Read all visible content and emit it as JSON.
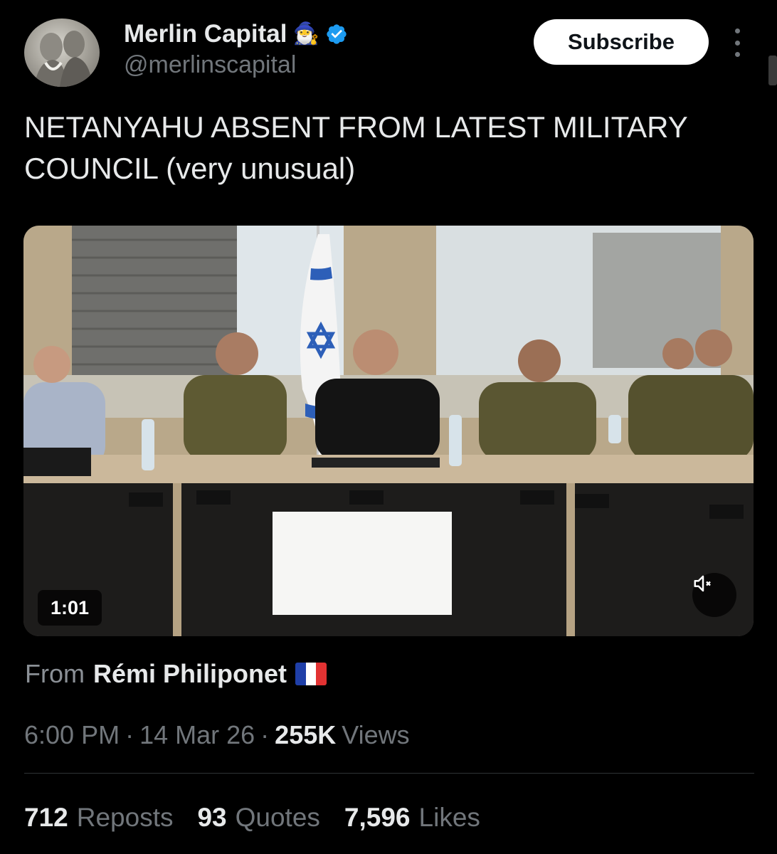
{
  "author": {
    "display_name": "Merlin Capital",
    "emoji": "🧙‍♂️",
    "handle": "@merlinscapital"
  },
  "actions": {
    "subscribe_label": "Subscribe"
  },
  "tweet": {
    "text": "NETANYAHU ABSENT FROM LATEST MILITARY COUNCIL (very unusual)"
  },
  "media": {
    "duration": "1:01"
  },
  "source": {
    "from_label": "From",
    "name": "Rémi Philiponet"
  },
  "meta": {
    "time": "6:00 PM",
    "sep1": "·",
    "date": "14 Mar 26",
    "sep2": "·",
    "views_count": "255K",
    "views_label": "Views"
  },
  "stats": {
    "reposts_count": "712",
    "reposts_label": "Reposts",
    "quotes_count": "93",
    "quotes_label": "Quotes",
    "likes_count": "7,596",
    "likes_label": "Likes"
  },
  "colors": {
    "background": "#000000",
    "text_primary": "#e7e9ea",
    "text_secondary": "#71767b",
    "verified": "#1d9bf0"
  }
}
